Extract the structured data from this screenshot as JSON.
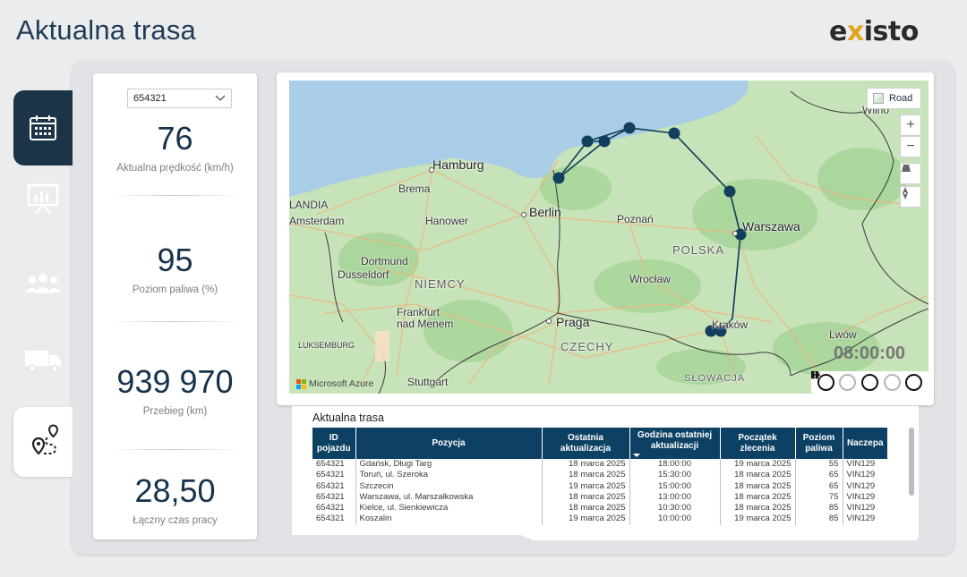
{
  "header": {
    "title": "Aktualna trasa",
    "logo_text_1": "e",
    "logo_x": "x",
    "logo_text_2": "isto"
  },
  "nav": {
    "items": [
      {
        "icon": "calendar-icon",
        "active": true
      },
      {
        "icon": "presentation-chart-icon",
        "active": false
      },
      {
        "icon": "people-icon",
        "active": false
      },
      {
        "icon": "truck-icon",
        "active": false
      },
      {
        "icon": "route-pin-icon",
        "active": false,
        "selected": true
      }
    ]
  },
  "kpi": {
    "vehicle_select": "654321",
    "speed_value": "76",
    "speed_label": "Aktualna prędkość (km/h)",
    "fuel_value": "95",
    "fuel_label": "Poziom paliwa (%)",
    "mileage_value": "939 970",
    "mileage_label": "Przebieg (km)",
    "worktime_value": "28,50",
    "worktime_label": "Łączny czas pracy"
  },
  "map": {
    "style_button": "Road",
    "zoom_in": "+",
    "zoom_out": "−",
    "attribution": "Microsoft Azure",
    "time": "08:00:00",
    "labels": {
      "hamburg": "Hamburg",
      "brema": "Brema",
      "amsterdam": "Amsterdam",
      "hanower": "Hanower",
      "berlin": "Berlin",
      "poznan": "Poznań",
      "warszawa": "Warszawa",
      "polska": "POLSKA",
      "dortmund": "Dortmund",
      "dusseldorf": "Dusseldorf",
      "niemcy": "NIEMCY",
      "wroclaw": "Wrocław",
      "frankfurt1": "Frankfurt",
      "frankfurt2": "nad Menem",
      "praga": "Praga",
      "czechy": "CZECHY",
      "krakow": "Kraków",
      "lwow": "Lwów",
      "luksemburg": "LUKSEMBURG",
      "stuttgart": "Stuttgart",
      "slowacja": "SŁOWACJA",
      "wilno": "Wilno",
      "landia": "LANDIA"
    }
  },
  "table": {
    "title": "Aktualna trasa",
    "columns": [
      "ID pojazdu",
      "Pozycja",
      "Ostatnia aktualizacja",
      "Godzina ostatniej aktualizacji",
      "Początek zlecenia",
      "Poziom paliwa",
      "Naczepa"
    ],
    "rows": [
      [
        "654321",
        "Gdańsk, Długi Targ",
        "18 marca 2025",
        "18:00:00",
        "19 marca 2025",
        "55",
        "VIN129"
      ],
      [
        "654321",
        "Toruń, ul. Szeroka",
        "18 marca 2025",
        "15:30:00",
        "18 marca 2025",
        "65",
        "VIN129"
      ],
      [
        "654321",
        "Szczecin",
        "19 marca 2025",
        "15:00:00",
        "18 marca 2025",
        "65",
        "VIN129"
      ],
      [
        "654321",
        "Warszawa, ul. Marszałkowska",
        "18 marca 2025",
        "13:00:00",
        "18 marca 2025",
        "75",
        "VIN129"
      ],
      [
        "654321",
        "Kielce, ul. Sienkiewicza",
        "18 marca 2025",
        "10:30:00",
        "18 marca 2025",
        "85",
        "VIN129"
      ],
      [
        "654321",
        "Koszalin",
        "19 marca 2025",
        "10:00:00",
        "19 marca 2025",
        "85",
        "VIN129"
      ]
    ]
  },
  "colors": {
    "route": "#0f3b5a",
    "header_bg": "#0d4163",
    "nav_active": "#1c3447",
    "accent": "#e0a51f"
  }
}
